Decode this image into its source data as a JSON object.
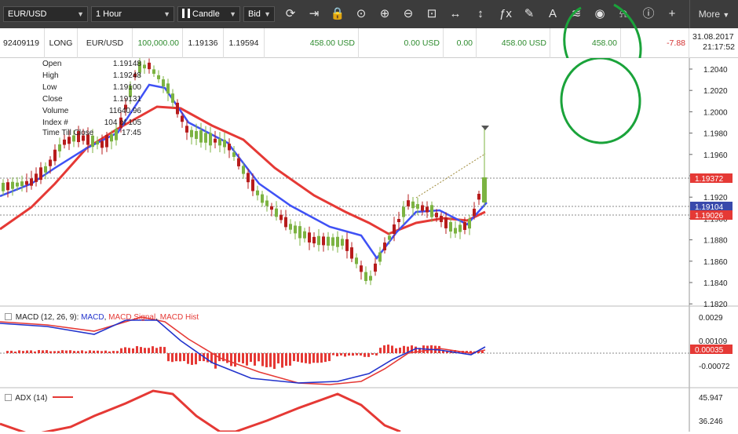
{
  "toolbar": {
    "symbol": "EUR/USD",
    "timeframe": "1 Hour",
    "chart_type": "Candle",
    "price_side": "Bid",
    "more_label": "More",
    "icons": [
      "refresh-icon",
      "arrow-right-icon",
      "lock-icon",
      "zoom-icon",
      "zoom-in-icon",
      "zoom-out-icon",
      "zoom-fit-icon",
      "horizontal-resize-icon",
      "vertical-resize-icon",
      "function-icon",
      "pencil-icon",
      "text-tool-icon",
      "layers-icon",
      "eye-icon",
      "alert-bell-icon",
      "info-icon",
      "crosshair-icon"
    ]
  },
  "position": {
    "id": "92409119",
    "side": "LONG",
    "symbol": "EUR/USD",
    "amount": "100,000.00",
    "open_price": "1.19136",
    "current_price": "1.19594",
    "pl_usd": "458.00 USD",
    "swap_usd": "0.00 USD",
    "commission": "0.00",
    "net_pl_usd": "458.00 USD",
    "pips": "458.00",
    "rollover": "-7.88",
    "date": "31.08.2017",
    "time": "21:17:52"
  },
  "ohlc": {
    "labels": [
      "Open",
      "High",
      "Low",
      "Close",
      "Volume",
      "Index #",
      "Time Till Close"
    ],
    "values": [
      "1.19148",
      "1.19248",
      "1.19100",
      "1.19131",
      "11640.96",
      "104 of 105",
      "17:45"
    ]
  },
  "price_axis": {
    "ticks": [
      "1.2040",
      "1.2020",
      "1.2000",
      "1.1980",
      "1.1960",
      "1.1940",
      "1.1920",
      "1.1900",
      "1.1880",
      "1.1860",
      "1.1840",
      "1.1820"
    ],
    "markers": [
      {
        "label": "1.19372",
        "color": "#e53935"
      },
      {
        "label": "1.19104",
        "color": "#3949ab"
      },
      {
        "label": "1.19026",
        "color": "#e53935"
      }
    ]
  },
  "macd": {
    "title_parts": [
      {
        "text": "MACD (12, 26, 9): ",
        "color": "#222222"
      },
      {
        "text": "MACD",
        "color": "#2233cc"
      },
      {
        "text": ", ",
        "color": "#222222"
      },
      {
        "text": "MACD Signal",
        "color": "#e53935"
      },
      {
        "text": ", ",
        "color": "#222222"
      },
      {
        "text": "MACD Hist",
        "color": "#e53935"
      }
    ],
    "ticks": [
      "0.0029",
      "0.00109",
      "-0.00072"
    ],
    "marker": {
      "label": "0.00035",
      "color": "#e53935"
    }
  },
  "adx": {
    "title": "ADX (14)",
    "ticks": [
      "45.947",
      "36.246"
    ]
  },
  "colors": {
    "up": "#7cb342",
    "down": "#b71c1c",
    "ma_fast": "#3f51f5",
    "ma_slow": "#e53935",
    "toolbar_bg": "#3c3c3c",
    "annotation": "#1aa33a"
  }
}
